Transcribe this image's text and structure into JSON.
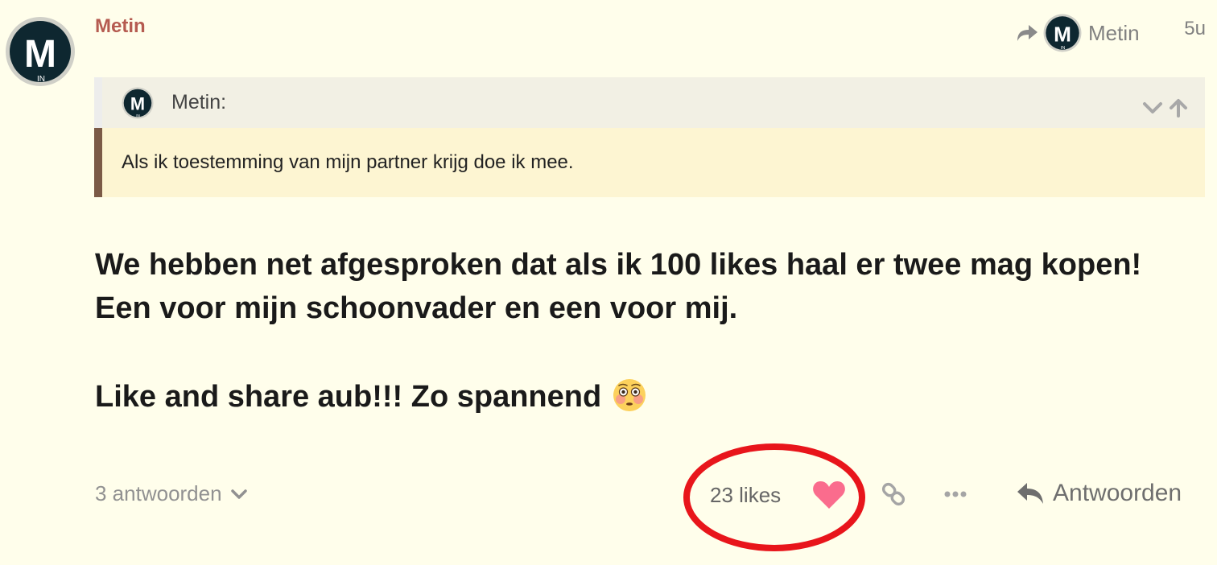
{
  "post": {
    "author": "Metin",
    "age": "5u",
    "reply_to": {
      "name": "Metin"
    },
    "quote": {
      "author": "Metin:",
      "text": "Als ik toestemming van mijn partner krijg doe ik mee."
    },
    "body": {
      "paragraph1": "We hebben net afgesproken dat als ik 100 likes haal er twee mag kopen! Een voor mijn schoonvader en een voor mij.",
      "paragraph2": "Like and share aub!!! Zo spannend",
      "emoji": "flushed-face-emoji"
    },
    "footer": {
      "replies": "3 antwoorden",
      "likes": "23 likes",
      "reply_button": "Antwoorden"
    }
  },
  "avatar": {
    "letter": "M",
    "sub": "IN"
  },
  "colors": {
    "background": "#fffeeb",
    "username": "#b55b50",
    "heart": "#fa6c8d",
    "quote_border": "#7b5a46",
    "quote_body_bg": "#fdf5d2",
    "highlight_ring": "#e8151b"
  },
  "icons": {
    "share": "share-arrow-icon",
    "expand": "chevron-down-icon",
    "jump_up": "arrow-up-icon",
    "like": "heart-icon",
    "link": "link-icon",
    "more": "ellipsis-icon",
    "reply": "reply-arrow-icon"
  }
}
